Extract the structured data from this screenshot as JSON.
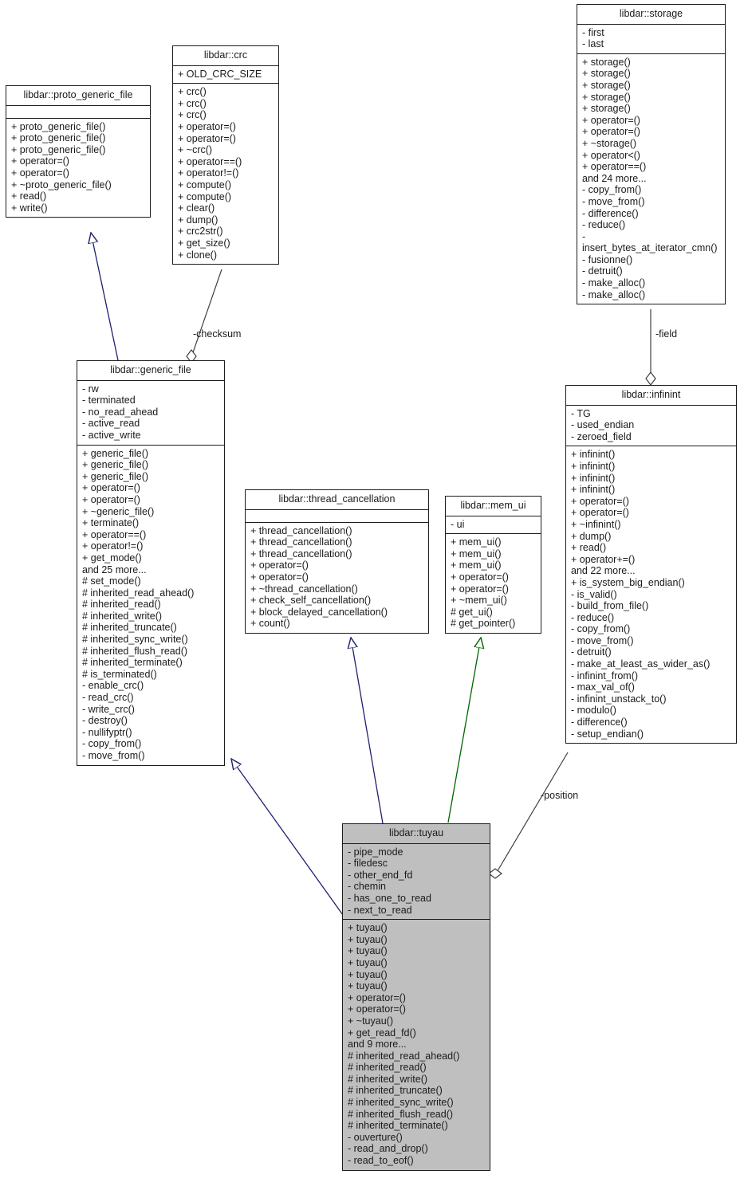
{
  "diagram": {
    "type": "uml-class-diagram",
    "colors": {
      "inheritance_arrow": "#1f1f70",
      "usage_arrow": "#006400",
      "aggregation_line": "#404040",
      "highlight_fill": "#bfbfbf",
      "box_fill": "#ffffff",
      "border": "#1c1c1c",
      "text": "#1a1a1a"
    }
  },
  "classes": {
    "proto_generic_file": {
      "name": "libdar::proto_generic_file",
      "attributes": [],
      "operations": [
        "+ proto_generic_file()",
        "+ proto_generic_file()",
        "+ proto_generic_file()",
        "+ operator=()",
        "+ operator=()",
        "+ ~proto_generic_file()",
        "+ read()",
        "+ write()"
      ]
    },
    "crc": {
      "name": "libdar::crc",
      "attributes": [
        "+ OLD_CRC_SIZE"
      ],
      "operations": [
        "+ crc()",
        "+ crc()",
        "+ crc()",
        "+ operator=()",
        "+ operator=()",
        "+ ~crc()",
        "+ operator==()",
        "+ operator!=()",
        "+ compute()",
        "+ compute()",
        "+ clear()",
        "+ dump()",
        "+ crc2str()",
        "+ get_size()",
        "+ clone()"
      ]
    },
    "storage": {
      "name": "libdar::storage",
      "attributes": [
        "- first",
        "- last"
      ],
      "operations": [
        "+ storage()",
        "+ storage()",
        "+ storage()",
        "+ storage()",
        "+ storage()",
        "+ operator=()",
        "+ operator=()",
        "+ ~storage()",
        "+ operator<()",
        "+ operator==()",
        "and 24 more...",
        "- copy_from()",
        "- move_from()",
        "- difference()",
        "- reduce()",
        "- insert_bytes_at_iterator_cmn()",
        "- fusionne()",
        "- detruit()",
        "- make_alloc()",
        "- make_alloc()"
      ]
    },
    "generic_file": {
      "name": "libdar::generic_file",
      "attributes": [
        "- rw",
        "- terminated",
        "- no_read_ahead",
        "- active_read",
        "- active_write"
      ],
      "operations": [
        "+ generic_file()",
        "+ generic_file()",
        "+ generic_file()",
        "+ operator=()",
        "+ operator=()",
        "+ ~generic_file()",
        "+ terminate()",
        "+ operator==()",
        "+ operator!=()",
        "+ get_mode()",
        "and 25 more...",
        "# set_mode()",
        "# inherited_read_ahead()",
        "# inherited_read()",
        "# inherited_write()",
        "# inherited_truncate()",
        "# inherited_sync_write()",
        "# inherited_flush_read()",
        "# inherited_terminate()",
        "# is_terminated()",
        "- enable_crc()",
        "- read_crc()",
        "- write_crc()",
        "- destroy()",
        "- nullifyptr()",
        "- copy_from()",
        "- move_from()"
      ]
    },
    "thread_cancellation": {
      "name": "libdar::thread_cancellation",
      "attributes": [],
      "operations": [
        "+ thread_cancellation()",
        "+ thread_cancellation()",
        "+ thread_cancellation()",
        "+ operator=()",
        "+ operator=()",
        "+ ~thread_cancellation()",
        "+ check_self_cancellation()",
        "+ block_delayed_cancellation()",
        "+ count()"
      ]
    },
    "mem_ui": {
      "name": "libdar::mem_ui",
      "attributes": [
        "- ui"
      ],
      "operations": [
        "+ mem_ui()",
        "+ mem_ui()",
        "+ mem_ui()",
        "+ operator=()",
        "+ operator=()",
        "+ ~mem_ui()",
        "# get_ui()",
        "# get_pointer()"
      ]
    },
    "infinint": {
      "name": "libdar::infinint",
      "attributes": [
        "- TG",
        "- used_endian",
        "- zeroed_field"
      ],
      "operations": [
        "+ infinint()",
        "+ infinint()",
        "+ infinint()",
        "+ infinint()",
        "+ operator=()",
        "+ operator=()",
        "+ ~infinint()",
        "+ dump()",
        "+ read()",
        "+ operator+=()",
        "and 22 more...",
        "+ is_system_big_endian()",
        "- is_valid()",
        "- build_from_file()",
        "- reduce()",
        "- copy_from()",
        "- move_from()",
        "- detruit()",
        "- make_at_least_as_wider_as()",
        "- infinint_from()",
        "- max_val_of()",
        "- infinint_unstack_to()",
        "- modulo()",
        "- difference()",
        "- setup_endian()"
      ]
    },
    "tuyau": {
      "name": "libdar::tuyau",
      "attributes": [
        "- pipe_mode",
        "- filedesc",
        "- other_end_fd",
        "- chemin",
        "- has_one_to_read",
        "- next_to_read"
      ],
      "operations": [
        "+ tuyau()",
        "+ tuyau()",
        "+ tuyau()",
        "+ tuyau()",
        "+ tuyau()",
        "+ tuyau()",
        "+ operator=()",
        "+ operator=()",
        "+ ~tuyau()",
        "+ get_read_fd()",
        "and 9 more...",
        "# inherited_read_ahead()",
        "# inherited_read()",
        "# inherited_write()",
        "# inherited_truncate()",
        "# inherited_sync_write()",
        "# inherited_flush_read()",
        "# inherited_terminate()",
        "- ouverture()",
        "- read_and_drop()",
        "- read_to_eof()"
      ]
    }
  },
  "edges": {
    "checksum_label": "-checksum",
    "field_label": "-field",
    "position_label": "-position"
  }
}
